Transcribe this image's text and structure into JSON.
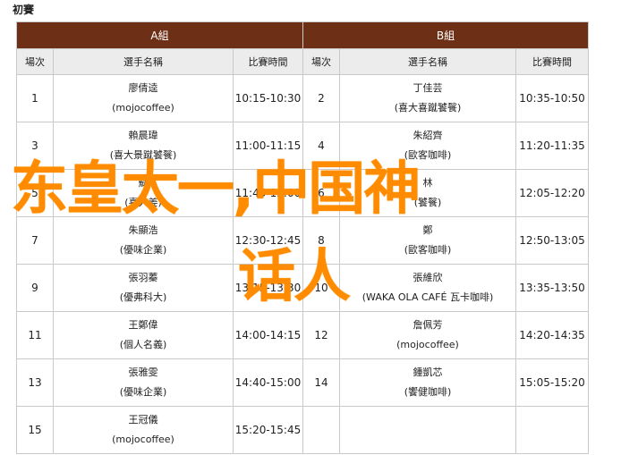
{
  "page": {
    "title": "初賽"
  },
  "groups": [
    "A組",
    "B組"
  ],
  "columns": [
    "場次",
    "選手名稱",
    "比賽時間",
    "場次",
    "選手名稱",
    "比賽時間"
  ],
  "rows": [
    {
      "a": {
        "round": "1",
        "name": "廖倩逵",
        "team": "(mojocoffee)",
        "time": "10:15-10:30"
      },
      "b": {
        "round": "2",
        "name": "丁佳芸",
        "team": "(喜大喜蹴饕餮)",
        "time": "10:35-10:50"
      }
    },
    {
      "a": {
        "round": "3",
        "name": "賴晨瑋",
        "team": "(喜大景蹴饕餮)",
        "time": "11:00-11:15"
      },
      "b": {
        "round": "4",
        "name": "朱紹齊",
        "team": "(歐客咖啡)",
        "time": "11:20-11:35"
      }
    },
    {
      "a": {
        "round": "5",
        "name": "蘇",
        "team": "(喜大姜)",
        "time": "11:45-12:00"
      },
      "b": {
        "round": "6",
        "name": "林",
        "team": "(饕餮)",
        "time": "12:05-12:20"
      }
    },
    {
      "a": {
        "round": "7",
        "name": "朱顯浩",
        "team": "(優味企業)",
        "time": "12:30-12:45"
      },
      "b": {
        "round": "8",
        "name": "鄭",
        "team": "(歐客咖啡)",
        "time": "12:50-13:05"
      }
    },
    {
      "a": {
        "round": "9",
        "name": "張羽蓁",
        "team": "(優弗科大)",
        "time": "13:15-13:30"
      },
      "b": {
        "round": "10",
        "name": "張維欣",
        "team": "(WAKA OLA CAFÉ 瓦卡咖啡)",
        "time": "13:35-13:50"
      }
    },
    {
      "a": {
        "round": "11",
        "name": "王鄭偉",
        "team": "(個人名義)",
        "time": "14:00-14:15"
      },
      "b": {
        "round": "12",
        "name": "詹佩芳",
        "team": "(mojocoffee)",
        "time": "14:20-14:35"
      }
    },
    {
      "a": {
        "round": "13",
        "name": "張雅雯",
        "team": "(優味企業)",
        "time": "14:40-15:00"
      },
      "b": {
        "round": "14",
        "name": "鍾凱芯",
        "team": "(饗健咖啡)",
        "time": "15:05-15:20"
      }
    },
    {
      "a": {
        "round": "15",
        "name": "王冠儀",
        "team": "(mojocoffee)",
        "time": "15:20-15:45"
      },
      "b": {
        "round": "",
        "name": "",
        "team": "",
        "time": ""
      }
    }
  ],
  "overlay": {
    "line1": "东皇太一,中国神",
    "line2": "话人"
  },
  "colors": {
    "header_bg": "#6d2f16",
    "subheader_bg": "#ececec",
    "overlay_text": "#ff8c00"
  }
}
